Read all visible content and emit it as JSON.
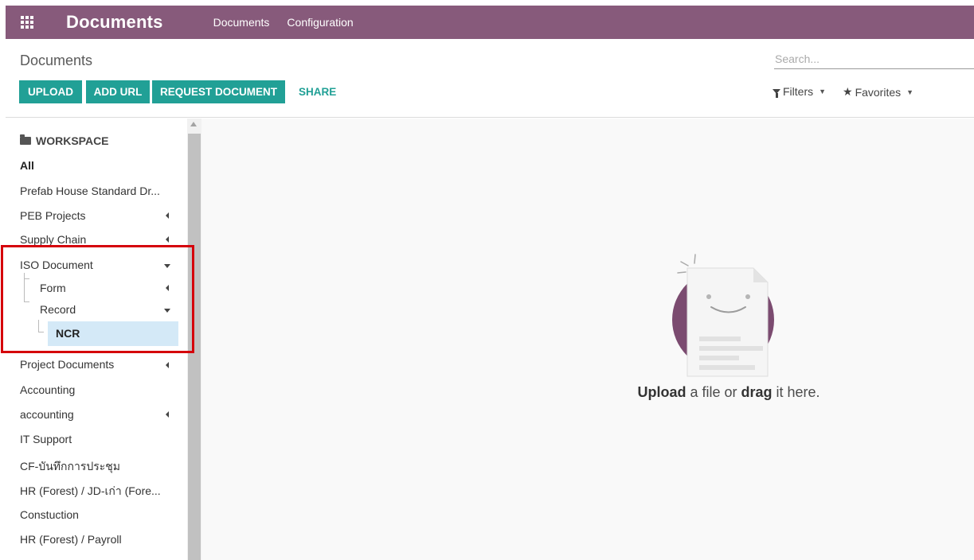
{
  "navbar": {
    "app_title": "Documents",
    "menu": [
      "Documents",
      "Configuration"
    ],
    "background": "#875a7b"
  },
  "control": {
    "breadcrumb": "Documents",
    "search_placeholder": "Search...",
    "buttons": {
      "upload": "UPLOAD",
      "add_url": "ADD URL",
      "request_document": "REQUEST DOCUMENT",
      "share": "SHARE"
    },
    "filters": "Filters",
    "favorites": "Favorites",
    "accent": "#21a096"
  },
  "sidebar": {
    "header": "WORKSPACE",
    "items": [
      {
        "label": "All",
        "expander": "none",
        "selected": true
      },
      {
        "label": "Prefab House Standard Dr...",
        "expander": "none"
      },
      {
        "label": "PEB Projects",
        "expander": "collapsed"
      },
      {
        "label": "Supply Chain",
        "expander": "collapsed"
      },
      {
        "label": "ISO Document",
        "expander": "expanded"
      },
      {
        "label": "Form",
        "expander": "collapsed",
        "depth": 1
      },
      {
        "label": "Record",
        "expander": "expanded",
        "depth": 1
      },
      {
        "label": "NCR",
        "expander": "none",
        "depth": 2,
        "active": true
      },
      {
        "label": "Project Documents",
        "expander": "collapsed"
      },
      {
        "label": "Accounting",
        "expander": "none"
      },
      {
        "label": "accounting",
        "expander": "collapsed"
      },
      {
        "label": "IT Support",
        "expander": "none"
      },
      {
        "label": "CF-บันทึกการประชุม",
        "expander": "none"
      },
      {
        "label": "HR (Forest) / JD-เก่า (Fore...",
        "expander": "none"
      },
      {
        "label": "Constuction",
        "expander": "none"
      },
      {
        "label": "HR (Forest) / Payroll",
        "expander": "none"
      }
    ]
  },
  "empty_state": {
    "bold1": "Upload",
    "middle": " a file or ",
    "bold2": "drag",
    "end": " it here."
  }
}
